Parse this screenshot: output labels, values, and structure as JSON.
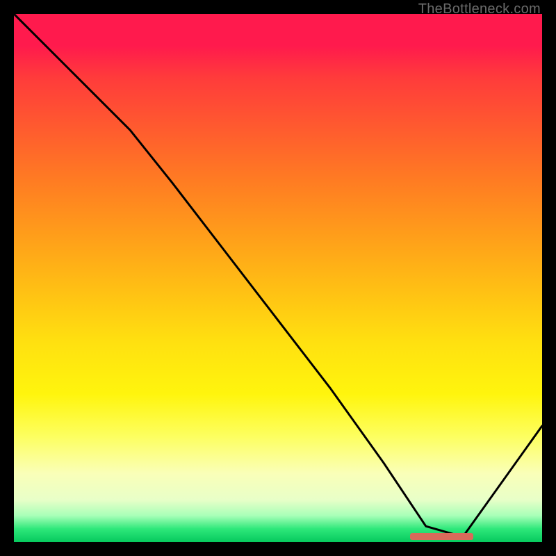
{
  "watermark": "TheBottleneck.com",
  "chart_data": {
    "type": "line",
    "title": "",
    "xlabel": "",
    "ylabel": "",
    "xlim": [
      0,
      100
    ],
    "ylim": [
      0,
      100
    ],
    "series": [
      {
        "name": "curve",
        "x": [
          0,
          10,
          22,
          30,
          40,
          50,
          60,
          70,
          78,
          85,
          100
        ],
        "y": [
          100,
          90,
          78,
          68,
          55,
          42,
          29,
          15,
          3,
          1,
          22
        ]
      }
    ],
    "annotations": [
      {
        "name": "target-band",
        "x_start": 75,
        "x_end": 87,
        "y": 1,
        "color": "#d96a5a"
      }
    ],
    "gradient_stops": [
      {
        "pos": 0,
        "color": "#ff1a4d"
      },
      {
        "pos": 0.5,
        "color": "#ffbf14"
      },
      {
        "pos": 0.8,
        "color": "#fdff60"
      },
      {
        "pos": 1.0,
        "color": "#06c95e"
      }
    ]
  }
}
